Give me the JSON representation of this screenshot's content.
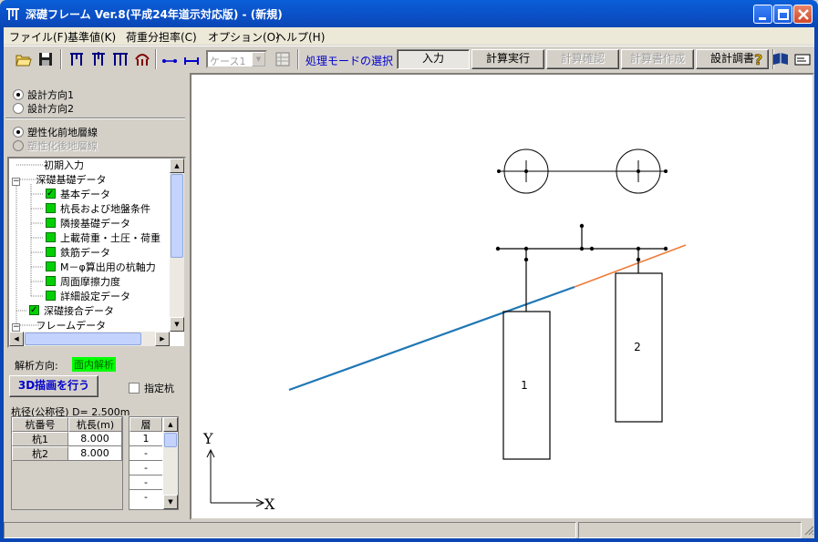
{
  "window": {
    "title": "深礎フレーム Ver.8(平成24年道示対応版) - (新規)",
    "colors": {
      "titlebar": "#0b4fc6",
      "accent": "#0000cc"
    }
  },
  "menu": [
    {
      "label": "ファイル(F)"
    },
    {
      "label": "基準値(K)"
    },
    {
      "label": "荷重分担率(C)"
    },
    {
      "label": "オプション(O)"
    },
    {
      "label": "ヘルプ(H)"
    }
  ],
  "toolbar": {
    "icons": [
      "open-folder-icon",
      "save-disk-icon",
      "frame-view-1-icon",
      "frame-view-2-icon",
      "frame-view-3-icon",
      "frame-view-4-icon",
      "member-1-icon",
      "member-2-icon",
      "case-table-icon",
      "help-icon",
      "book-icon",
      "card-icon"
    ],
    "case_select": "ケース1",
    "mode_label": "処理モードの選択",
    "buttons": {
      "input": "入力",
      "run": "計算実行",
      "check": "計算確認",
      "report": "計算書作成",
      "design": "設計調書"
    }
  },
  "left_panel": {
    "direction_options": [
      {
        "label": "設計方向1",
        "selected": true
      },
      {
        "label": "設計方向2",
        "selected": false
      }
    ],
    "layer_options": [
      {
        "label": "塑性化前地層線",
        "selected": true,
        "enabled": true
      },
      {
        "label": "塑性化後地層線",
        "selected": false,
        "enabled": false
      }
    ],
    "tree": [
      {
        "label": "初期入力",
        "kind": "leaf"
      },
      {
        "label": "深礎基礎データ",
        "kind": "folder"
      },
      {
        "label": "基本データ",
        "kind": "checked-green"
      },
      {
        "label": "杭長および地盤条件",
        "kind": "green"
      },
      {
        "label": "隣接基礎データ",
        "kind": "green"
      },
      {
        "label": "上載荷重・土圧・荷重",
        "kind": "green"
      },
      {
        "label": "鉄筋データ",
        "kind": "green"
      },
      {
        "label": "M－φ算出用の杭軸力",
        "kind": "green"
      },
      {
        "label": "周面摩擦力度",
        "kind": "green"
      },
      {
        "label": "詳細設定データ",
        "kind": "green"
      },
      {
        "label": "深礎接合データ",
        "kind": "checked"
      },
      {
        "label": "フレームデータ",
        "kind": "folder"
      }
    ],
    "analysis_label": "解析方向:",
    "analysis_value": "面内解析",
    "btn_3d": "3D描画を行う",
    "specified_pile": "指定杭",
    "diameter": "杭径(公称径) D= 2.500m",
    "pile_table": {
      "headers": [
        "杭番号",
        "杭長(m)"
      ],
      "rows": [
        [
          "杭1",
          "8.000"
        ],
        [
          "杭2",
          "8.000"
        ]
      ]
    },
    "layer_table": {
      "header": "層",
      "rows": [
        "1",
        "-",
        "-",
        "-",
        "-",
        "-"
      ]
    }
  },
  "canvas": {
    "pile_labels": [
      "1",
      "2"
    ],
    "axis": {
      "y": "Y",
      "x": "X"
    },
    "colors": {
      "ground_before": "#1f77b4",
      "ground_after": "#f07c3c"
    }
  }
}
